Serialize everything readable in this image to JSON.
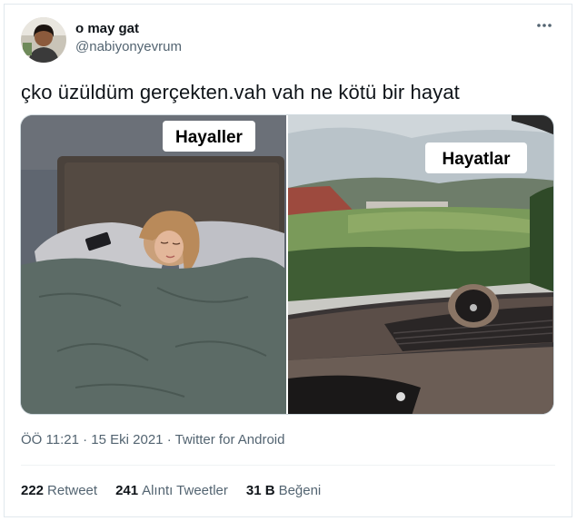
{
  "user": {
    "display_name": "o may gat",
    "handle": "@nabiyonyevrum"
  },
  "tweet": {
    "text": "çko üzüldüm gerçekten.vah vah ne kötü bir hayat",
    "media": {
      "left_caption": "Hayaller",
      "right_caption": "Hayatlar"
    }
  },
  "meta": {
    "time": "ÖÖ 11:21",
    "sep1": "·",
    "date": "15 Eki 2021",
    "sep2": "·",
    "source": "Twitter for Android"
  },
  "stats": {
    "retweets_count": "222",
    "retweets_label": "Retweet",
    "quotes_count": "241",
    "quotes_label": "Alıntı Tweetler",
    "likes_count": "31 B",
    "likes_label": "Beğeni"
  },
  "icons": {
    "more": "more-horizontal-icon"
  },
  "colors": {
    "text_primary": "#0f1419",
    "text_secondary": "#536471",
    "border": "#cfd9de"
  }
}
